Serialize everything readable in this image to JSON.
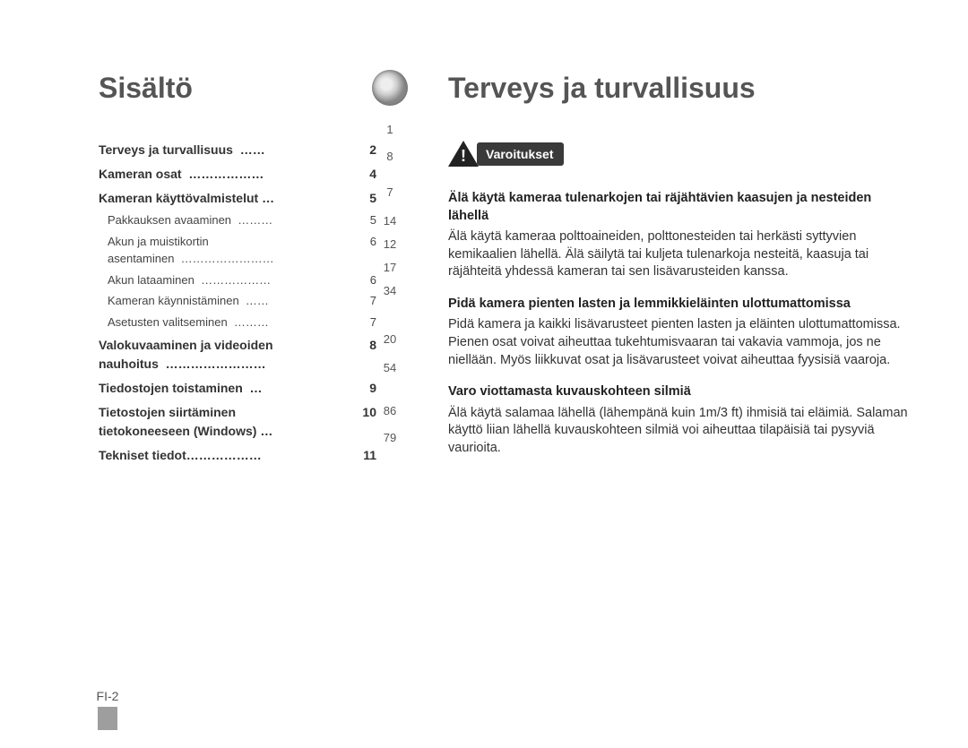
{
  "left": {
    "heading": "Sisältö",
    "toc": [
      {
        "bold": true,
        "label": "Terveys ja turvallisuus  ……",
        "page": "2"
      },
      {
        "bold": true,
        "label": "Kameran osat  ………………",
        "page": "4"
      },
      {
        "bold": true,
        "label": "Kameran käyttövalmistelut …",
        "page": "5"
      },
      {
        "bold": false,
        "label": "Pakkauksen avaaminen  ………",
        "page": "5"
      },
      {
        "bold": false,
        "label": "Akun ja muistikortin\nasentaminen  ……………………",
        "page": "6"
      },
      {
        "bold": false,
        "label": "Akun lataaminen  ………………",
        "page": "6"
      },
      {
        "bold": false,
        "label": "Kameran käynnistäminen  ……",
        "page": "7"
      },
      {
        "bold": false,
        "label": "Asetusten valitseminen  ………",
        "page": "7"
      },
      {
        "bold": true,
        "label": "Valokuvaaminen ja videoiden\nnauhoitus  ……………………",
        "page": "8"
      },
      {
        "bold": true,
        "label": "Tiedostojen toistaminen  …",
        "page": "9"
      },
      {
        "bold": true,
        "label": "Tietostojen siirtäminen\ntietokoneeseen (Windows) …",
        "page": "10"
      },
      {
        "bold": true,
        "label": "Tekniset tiedot………………",
        "page": "11"
      }
    ]
  },
  "thumb_index": [
    "1",
    "8",
    "7",
    "14",
    "12",
    "17",
    "34",
    "20",
    "54",
    "86",
    "79"
  ],
  "right": {
    "heading": "Terveys ja turvallisuus",
    "warn_label": "Varoitukset",
    "blocks": [
      {
        "title": "Älä käytä kameraa tulenarkojen tai räjähtävien kaasujen ja nesteiden lähellä",
        "body": "Älä käytä kameraa polttoaineiden, polttonesteiden tai herkästi syttyvien kemikaalien lähellä. Älä säilytä tai kuljeta tulenarkoja nesteitä, kaasuja tai räjähteitä yhdessä kameran tai sen lisävarusteiden kanssa."
      },
      {
        "title": "Pidä kamera pienten lasten ja lemmikkieläinten ulottumattomissa",
        "body": "Pidä kamera ja kaikki lisävarusteet pienten lasten ja eläinten ulottumattomissa. Pienen osat voivat aiheuttaa tukehtumisvaaran tai vakavia vammoja, jos ne niellään. Myös liikkuvat osat ja lisävarusteet voivat aiheuttaa fyysisiä vaaroja."
      },
      {
        "title": "Varo viottamasta kuvauskohteen silmiä",
        "body": "Älä käytä salamaa lähellä (lähempänä kuin 1m/3 ft) ihmisiä tai eläimiä. Salaman käyttö liian lähellä kuvauskohteen silmiä voi aiheuttaa tilapäisiä tai pysyviä vaurioita."
      }
    ]
  },
  "page_footer": "FI-2"
}
